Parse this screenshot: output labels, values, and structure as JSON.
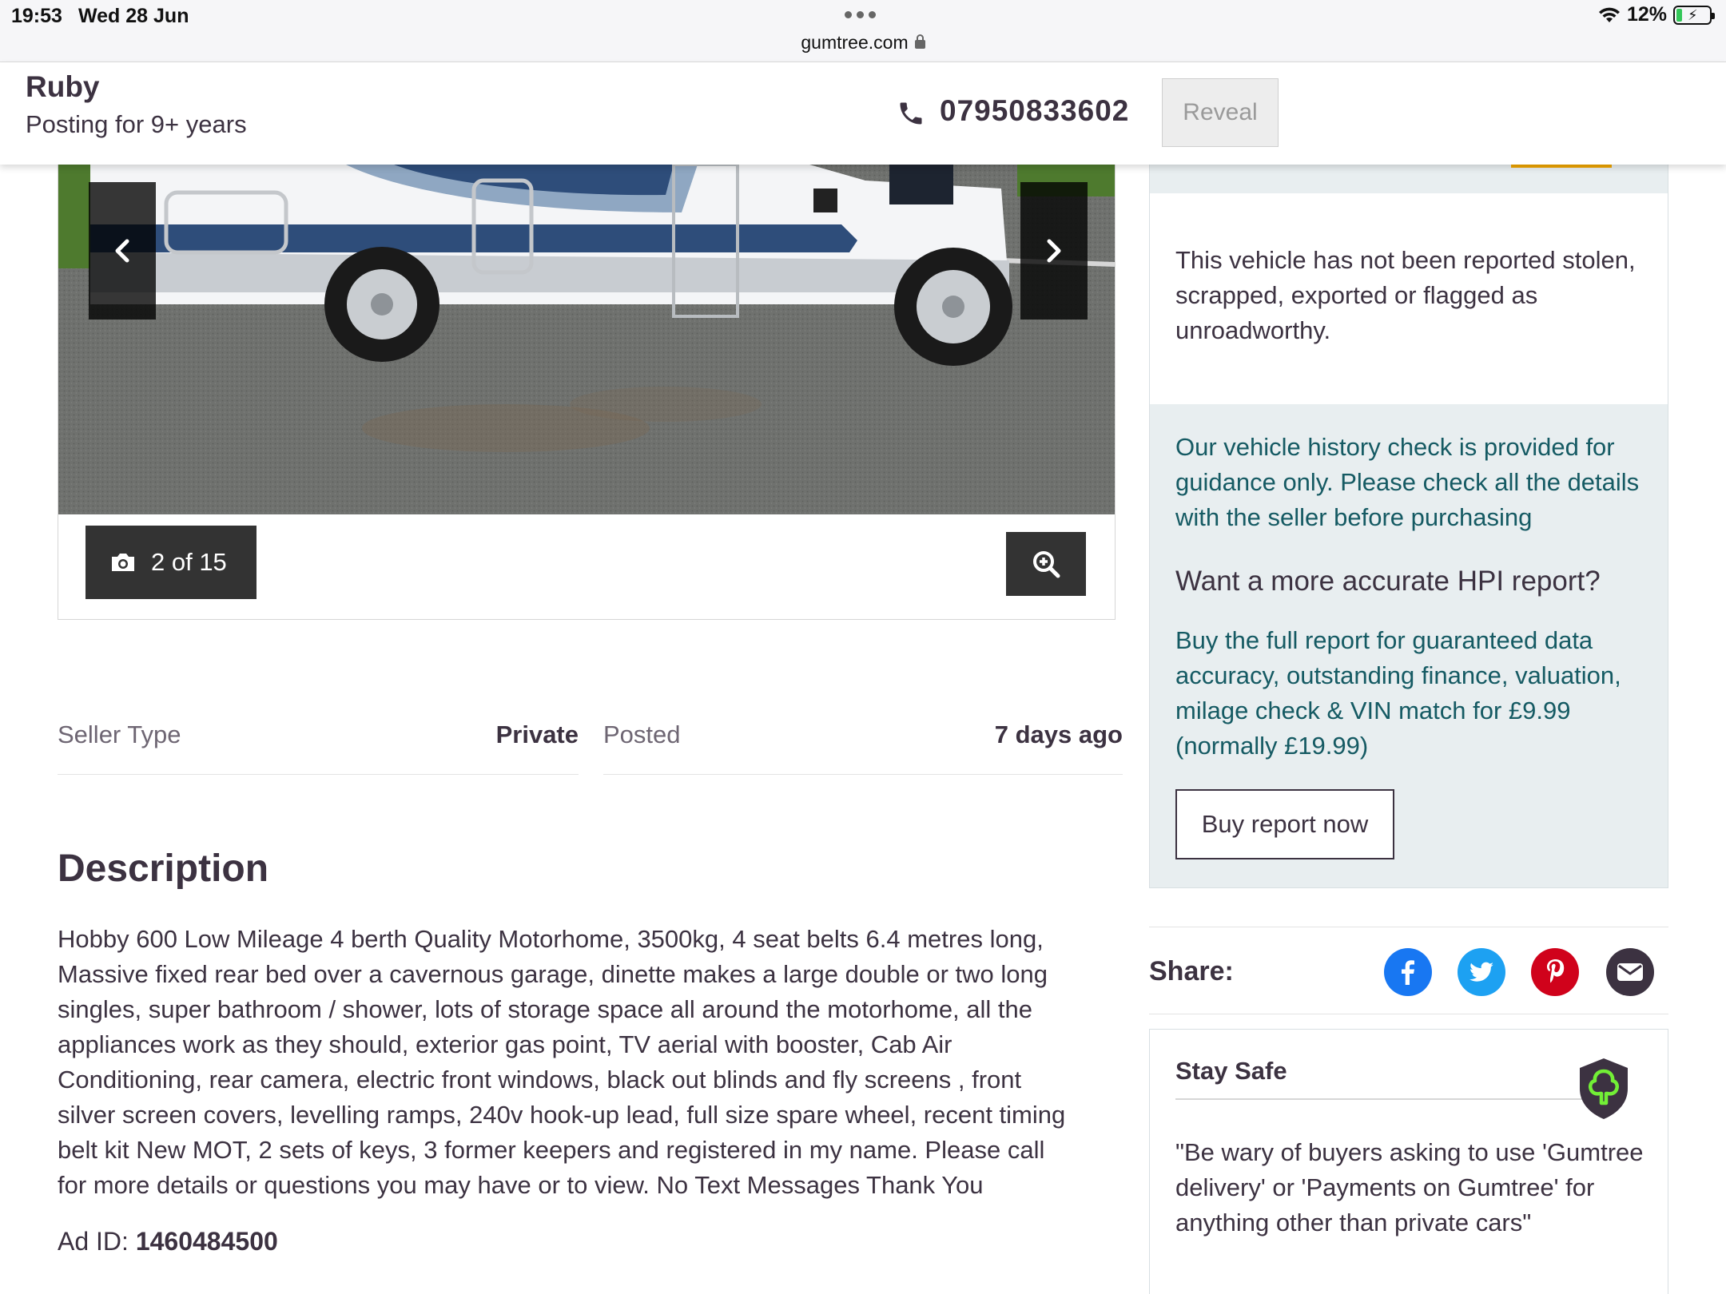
{
  "status_bar": {
    "time": "19:53",
    "date": "Wed 28 Jun",
    "url": "gumtree.com",
    "battery": "12%"
  },
  "seller": {
    "name": "Ruby",
    "since": "Posting for 9+ years",
    "phone": "07950833602",
    "reveal_label": "Reveal"
  },
  "gallery": {
    "counter": "2 of 15",
    "icons": [
      "chevron-left-icon",
      "chevron-right-icon",
      "camera-icon",
      "zoom-in-icon"
    ]
  },
  "meta": {
    "seller_type_label": "Seller Type",
    "seller_type_value": "Private",
    "posted_label": "Posted",
    "posted_value": "7 days ago"
  },
  "description": {
    "heading": "Description",
    "lines": [
      "Hobby 600 Low Mileage 4 berth Quality Motorhome, 3500kg, 4 seat belts 6.4 metres long,",
      "Massive fixed rear bed over a cavernous garage, dinette makes a large double or two long",
      "singles, super bathroom / shower, lots of storage space all around the motorhome, all the",
      "appliances work as they should, exterior gas point, TV aerial with booster, Cab Air",
      "Conditioning, rear camera, electric front windows, black out blinds and fly screens , front",
      "silver screen covers, levelling ramps, 240v hook-up lead, full size spare wheel, recent timing",
      "belt kit New MOT, 2 sets of keys, 3 former keepers and registered in my name. Please call",
      "for more details or questions you may have or to view. No Text Messages Thank You"
    ],
    "ad_id_label": "Ad ID:",
    "ad_id_value": "1460484500"
  },
  "sidebar": {
    "vehicle_status": "This vehicle has not been reported stolen, scrapped, exported or flagged as unroadworthy.",
    "hpi_guidance": "Our vehicle history check is provided for guidance only. Please check all the details with the seller before purchasing",
    "hpi_question": "Want a more accurate HPI report?",
    "hpi_offer": "Buy the full report for guaranteed data accuracy, outstanding finance, valuation, milage check & VIN match for £9.99 (normally £19.99)",
    "buy_label": "Buy report now",
    "share_label": "Share:",
    "share_icons": [
      "facebook-icon",
      "twitter-icon",
      "pinterest-icon",
      "email-icon"
    ],
    "safe_title": "Stay Safe",
    "safe_quote": "\"Be wary of buyers asking to use 'Gumtree delivery' or 'Payments on Gumtree' for anything other than private cars\""
  },
  "colors": {
    "brand_dark": "#3c3241",
    "hpi_text": "#155a63",
    "hpi_background": "#e8eef0",
    "gumtree_green": "#72ef36",
    "accent_orange": "#f0a500"
  }
}
